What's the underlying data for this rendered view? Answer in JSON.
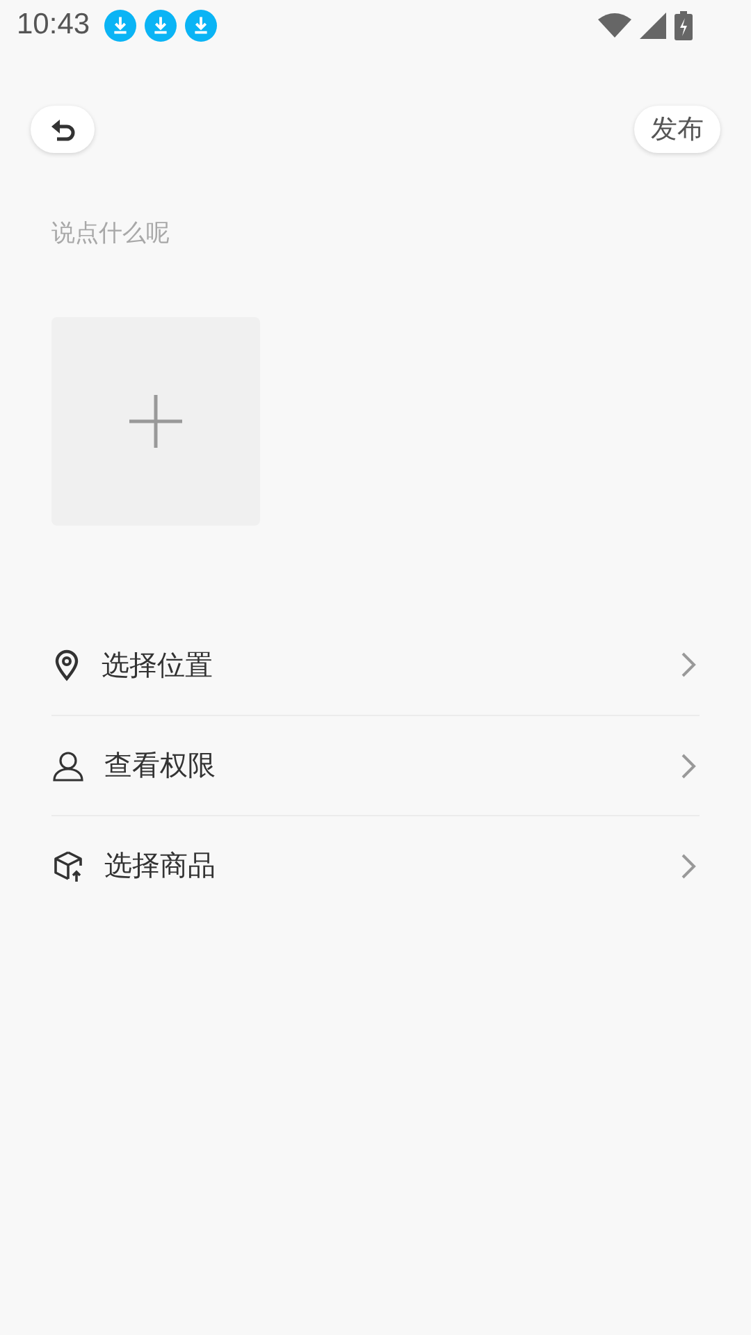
{
  "status_bar": {
    "time": "10:43",
    "notifications": [
      {
        "kind": "download"
      },
      {
        "kind": "download"
      },
      {
        "kind": "download"
      }
    ]
  },
  "header": {
    "publish": "发布"
  },
  "post": {
    "placeholder": "说点什么呢"
  },
  "options": [
    {
      "label": "选择位置"
    },
    {
      "label": "查看权限"
    },
    {
      "label": "选择商品"
    }
  ]
}
